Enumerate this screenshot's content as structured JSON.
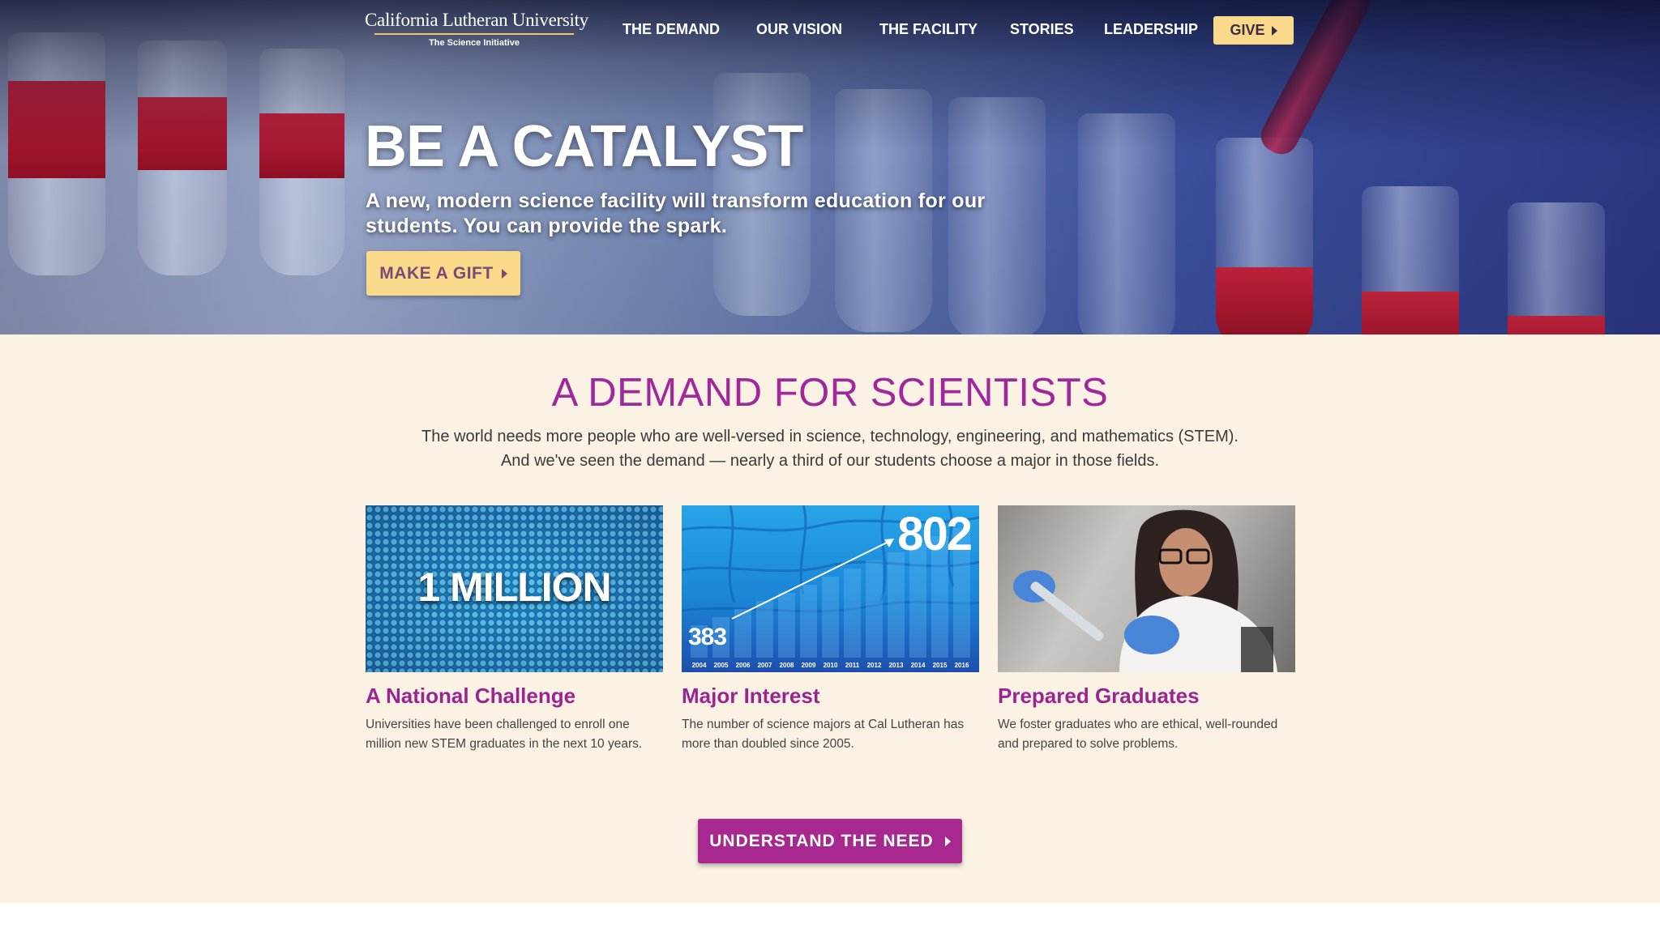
{
  "header": {
    "logo_title": "California Lutheran University",
    "logo_subtitle": "The Science Initiative",
    "nav": [
      {
        "label": "THE DEMAND"
      },
      {
        "label": "OUR VISION"
      },
      {
        "label": "THE FACILITY"
      },
      {
        "label": "STORIES"
      },
      {
        "label": "LEADERSHIP"
      }
    ],
    "give_label": "GIVE"
  },
  "hero": {
    "title": "BE A CATALYST",
    "subtitle": "A new, modern science facility will transform education for our students. You can provide the spark.",
    "cta_label": "MAKE A GIFT"
  },
  "demand": {
    "title": "A DEMAND FOR SCIENTISTS",
    "text_line1": "The world needs more people who are well-versed in science, technology, engineering, and mathematics (STEM).",
    "text_line2": "And we've seen the demand — nearly a third of our students choose a major in those fields.",
    "cards": [
      {
        "image_text": "1 MILLION",
        "title": "A National Challenge",
        "text": "Universities have been challenged to enroll one million new STEM graduates in the next 10 years."
      },
      {
        "image_number_high": "802",
        "image_number_low": "383",
        "image_years": [
          "2004",
          "2005",
          "2006",
          "2007",
          "2008",
          "2009",
          "2010",
          "2011",
          "2012",
          "2013",
          "2014",
          "2015",
          "2016"
        ],
        "title": "Major Interest",
        "text": "The number of science majors at Cal Lutheran has more than doubled since 2005."
      },
      {
        "title": "Prepared Graduates",
        "text": "We foster graduates who are ethical, well-rounded and prepared to solve problems."
      }
    ],
    "cta_label": "UNDERSTAND THE NEED"
  },
  "colors": {
    "accent_purple": "#a7288f",
    "heading_purple": "#a0289a",
    "gold_button": "#fbd98a",
    "cream_background": "#fbf2e3"
  },
  "icons": {
    "button_caret": "caret-right-icon"
  }
}
